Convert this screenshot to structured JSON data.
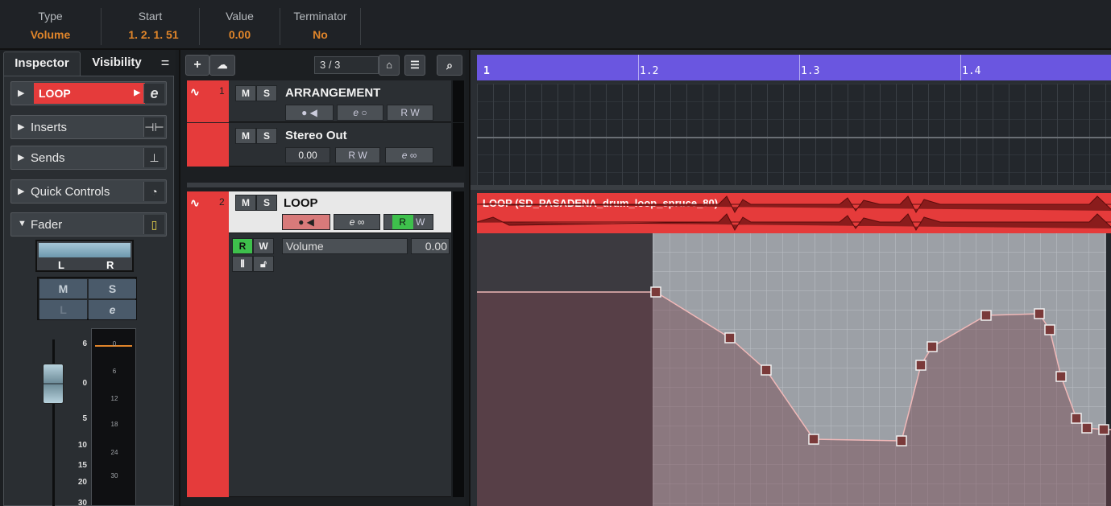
{
  "info_line": {
    "fields": [
      {
        "label": "Type",
        "value": "Volume"
      },
      {
        "label": "Start",
        "value": "1. 2. 1. 51"
      },
      {
        "label": "Value",
        "value": "0.00"
      },
      {
        "label": "Terminator",
        "value": "No"
      }
    ]
  },
  "inspector": {
    "tabs": {
      "active": "Inspector",
      "other": "Visibility",
      "menu": "="
    },
    "track_name": "LOOP",
    "sections": [
      "Inserts",
      "Sends",
      "Quick Controls",
      "Fader"
    ],
    "panner": {
      "left": "L",
      "right": "R"
    },
    "ms": {
      "mute": "M",
      "solo": "S",
      "listen": "L",
      "edit": "e"
    },
    "fader_scale": [
      "6",
      "0",
      "5",
      "10",
      "15",
      "20",
      "30"
    ],
    "meter_scale": [
      "0",
      "6",
      "12",
      "18",
      "24",
      "30"
    ]
  },
  "tracklist": {
    "counter": "3 / 3",
    "tracks": [
      {
        "number": "1",
        "name": "ARRANGEMENT"
      },
      {
        "number": "",
        "name": "Stereo Out",
        "volume": "0.00"
      },
      {
        "number": "2",
        "name": "LOOP"
      }
    ],
    "automation": {
      "param": "Volume",
      "value": "0.00"
    },
    "buttons": {
      "mute": "M",
      "solo": "S",
      "read": "R",
      "write": "W"
    }
  },
  "project": {
    "ruler": [
      "1",
      "1.2",
      "1.3",
      "1.4"
    ],
    "event_name": "LOOP (SD_PASADENA_drum_loop_spruce_80)"
  },
  "colors": {
    "accent": "#e0852a",
    "track": "#e53b3b",
    "ruler": "#6a56e0",
    "rw_active": "#3ec04c"
  }
}
